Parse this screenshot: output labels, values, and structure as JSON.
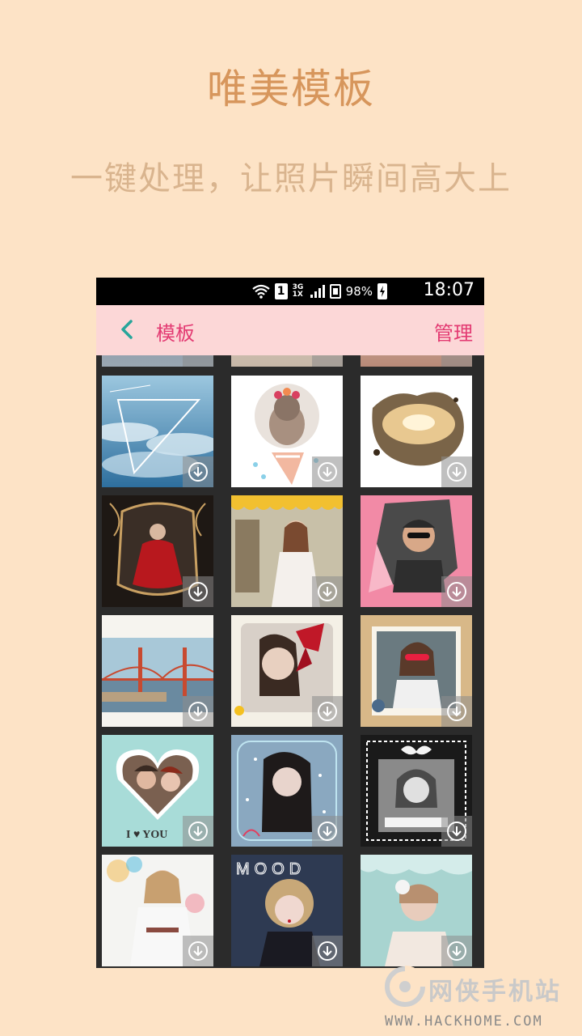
{
  "promo": {
    "title": "唯美模板",
    "subtitle": "一键处理，让照片瞬间高大上"
  },
  "status_bar": {
    "sim_slot": "1",
    "network": "3G 1X",
    "battery": "98%",
    "time": "18:07"
  },
  "app_bar": {
    "back_icon": "chevron-left-icon",
    "title": "模板",
    "manage_label": "管理"
  },
  "templates": [
    {
      "row": 1,
      "col": 1,
      "name": "clouds-triangle",
      "icon": "download-icon"
    },
    {
      "row": 1,
      "col": 2,
      "name": "cat-flower-crown",
      "icon": "download-icon"
    },
    {
      "row": 1,
      "col": 3,
      "name": "sunset-splash",
      "icon": "download-icon"
    },
    {
      "row": 2,
      "col": 1,
      "name": "ornate-frame-red-dress",
      "icon": "download-icon"
    },
    {
      "row": 2,
      "col": 2,
      "name": "girl-scalloped-frame",
      "icon": "download-icon"
    },
    {
      "row": 2,
      "col": 3,
      "name": "pink-paper-tear",
      "icon": "download-icon"
    },
    {
      "row": 3,
      "col": 1,
      "name": "golden-gate-bridge",
      "icon": "download-icon"
    },
    {
      "row": 3,
      "col": 2,
      "name": "red-bow-portrait",
      "icon": "download-icon"
    },
    {
      "row": 3,
      "col": 3,
      "name": "stamp-frame-sunglasses",
      "icon": "download-icon"
    },
    {
      "row": 4,
      "col": 1,
      "name": "heart-couple",
      "icon": "download-icon"
    },
    {
      "row": 4,
      "col": 2,
      "name": "winter-girl",
      "icon": "download-icon"
    },
    {
      "row": 4,
      "col": 3,
      "name": "vintage-bow-frame",
      "icon": "download-icon"
    },
    {
      "row": 5,
      "col": 1,
      "name": "watercolor-girl",
      "icon": "download-icon"
    },
    {
      "row": 5,
      "col": 2,
      "name": "mood-curly-hair",
      "icon": "download-icon"
    },
    {
      "row": 5,
      "col": 3,
      "name": "lace-headpiece",
      "icon": "download-icon"
    }
  ],
  "tile_texts": {
    "heart_caption": "I ♥ YOU",
    "mood_caption": "MOOD"
  },
  "watermark": {
    "text": "网侠手机站",
    "url": "WWW.HACKHOME.COM"
  }
}
